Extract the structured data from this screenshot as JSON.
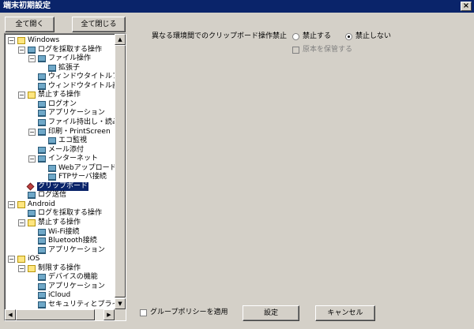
{
  "window": {
    "title": "端末初期設定",
    "close_label": "×"
  },
  "toolbar": {
    "expand_all": "全て開く",
    "collapse_all": "全て閉じる"
  },
  "tree": {
    "nodes": [
      {
        "label": "Windows"
      },
      {
        "label": "ログを採取する操作"
      },
      {
        "label": "ファイル操作"
      },
      {
        "label": "拡張子"
      },
      {
        "label": "ウィンドウタイトルフィル"
      },
      {
        "label": "ウィンドウタイトル画面キ"
      },
      {
        "label": "禁止する操作"
      },
      {
        "label": "ログオン"
      },
      {
        "label": "アプリケーション"
      },
      {
        "label": "ファイル持出し・読み込み"
      },
      {
        "label": "印刷・PrintScreen"
      },
      {
        "label": "エコ監視"
      },
      {
        "label": "メール添付"
      },
      {
        "label": "インターネット"
      },
      {
        "label": "Webアップロード・ダ"
      },
      {
        "label": "FTPサーバ接続"
      },
      {
        "label": "クリップボード"
      },
      {
        "label": "ログ送信"
      },
      {
        "label": "Android"
      },
      {
        "label": "ログを採取する操作"
      },
      {
        "label": "禁止する操作"
      },
      {
        "label": "Wi-Fi接続"
      },
      {
        "label": "Bluetooth接続"
      },
      {
        "label": "アプリケーション"
      },
      {
        "label": "iOS"
      },
      {
        "label": "制限する操作"
      },
      {
        "label": "デバイスの機能"
      },
      {
        "label": "アプリケーション"
      },
      {
        "label": "iCloud"
      },
      {
        "label": "セキュリティとプライバシ"
      }
    ],
    "selected_index": 16
  },
  "settings": {
    "clipboard_label": "異なる環境間でのクリップボード操作禁止",
    "prohibit_label": "禁止する",
    "allow_label": "禁止しない",
    "keep_original_label": "原本を保管する",
    "selected": "禁止しない"
  },
  "footer": {
    "group_policy_label": "グループポリシーを適用",
    "apply_label": "設定",
    "cancel_label": "キャンセル"
  }
}
